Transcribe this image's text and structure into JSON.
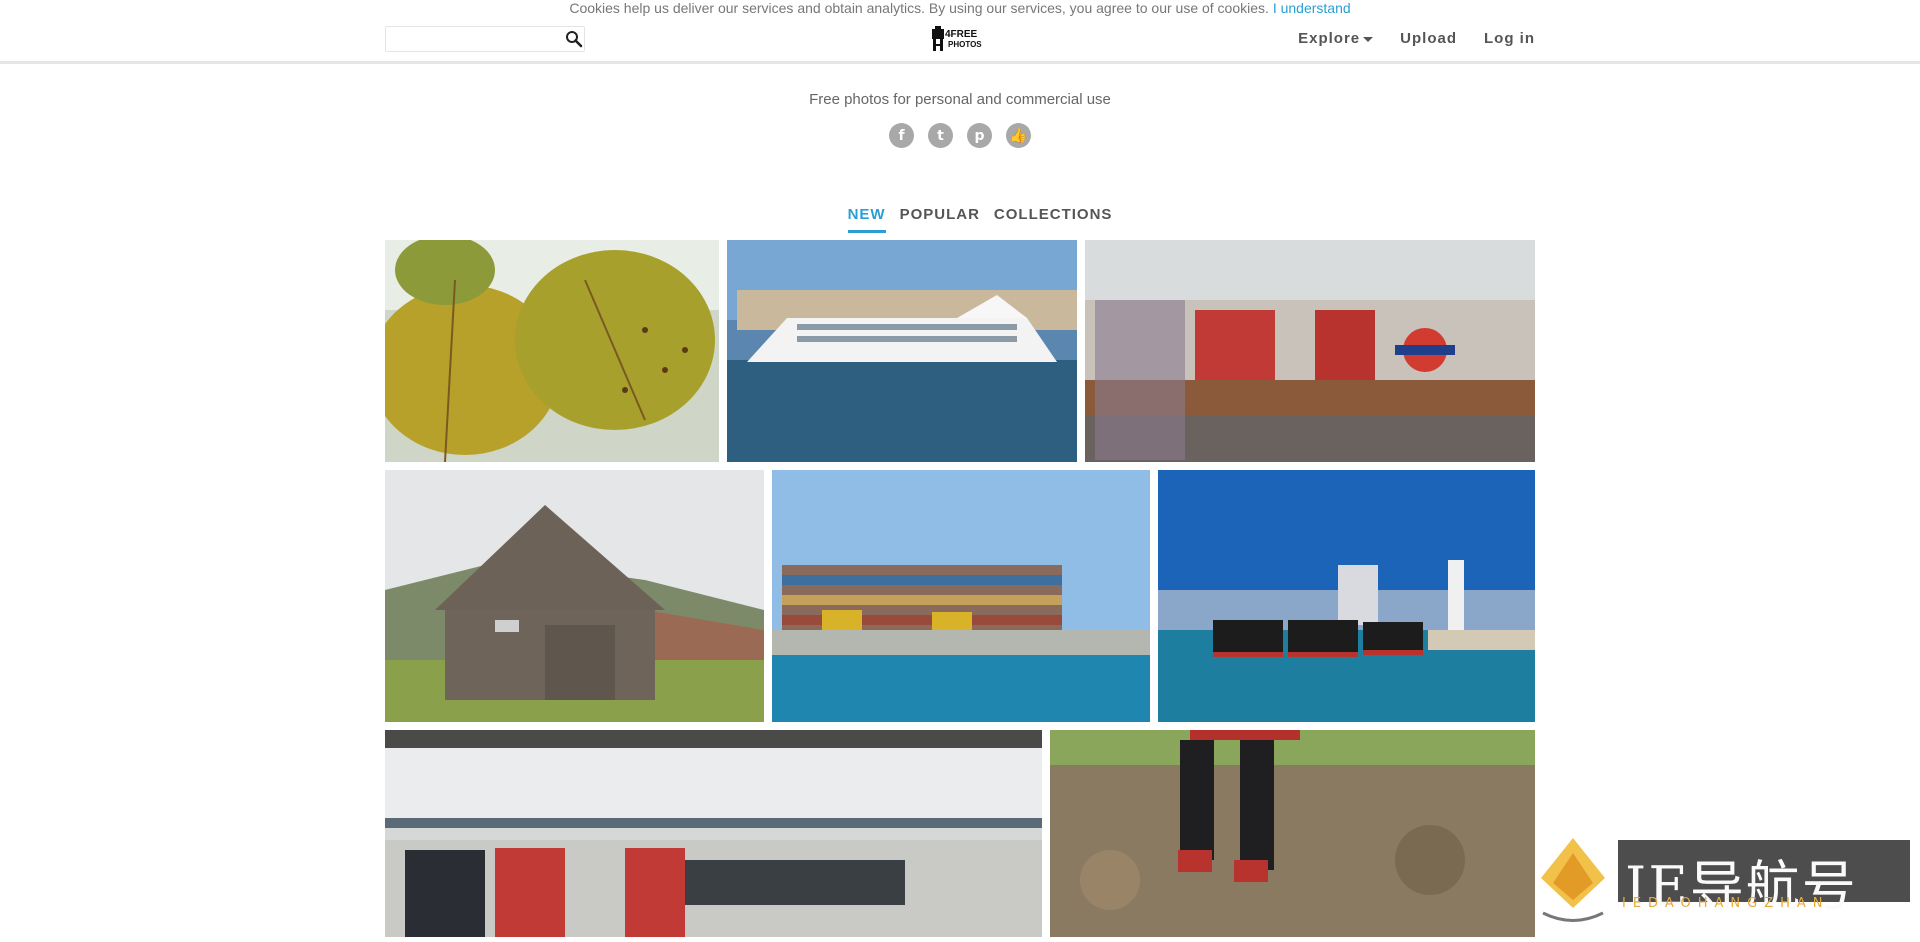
{
  "cookie_bar": {
    "message": "Cookies help us deliver our services and obtain analytics. By using our services, you agree to our use of cookies.",
    "accept_label": "I understand"
  },
  "header": {
    "search": {
      "placeholder": "",
      "icon": "search-icon"
    },
    "logo": {
      "line1": "4FREE",
      "line2": "PHOTOS"
    },
    "nav": {
      "explore": "Explore",
      "upload": "Upload",
      "login": "Log in"
    }
  },
  "hero": {
    "tagline": "Free photos for personal and commercial use",
    "social": [
      {
        "name": "facebook-icon",
        "glyph": "f"
      },
      {
        "name": "twitter-icon",
        "glyph": "t"
      },
      {
        "name": "pinterest-icon",
        "glyph": "p"
      },
      {
        "name": "like-icon",
        "glyph": "👍"
      }
    ]
  },
  "tabs": [
    {
      "label": "NEW",
      "active": true
    },
    {
      "label": "POPULAR",
      "active": false
    },
    {
      "label": "COLLECTIONS",
      "active": false
    }
  ],
  "photos": [
    {
      "name": "photo-autumn-leaves"
    },
    {
      "name": "photo-cruise-ship"
    },
    {
      "name": "photo-underground-train-blur"
    },
    {
      "name": "photo-wooden-barn"
    },
    {
      "name": "photo-container-port"
    },
    {
      "name": "photo-tugboats-harbor"
    },
    {
      "name": "photo-train-platform"
    },
    {
      "name": "photo-legs-autumn-leaves"
    }
  ],
  "watermark": {
    "text": "IE导航号",
    "subtext": "IEDAOHANGZHAN"
  },
  "colors": {
    "accent": "#2a9fd6",
    "text": "#555555",
    "icon_gray": "#a8a8a8"
  }
}
